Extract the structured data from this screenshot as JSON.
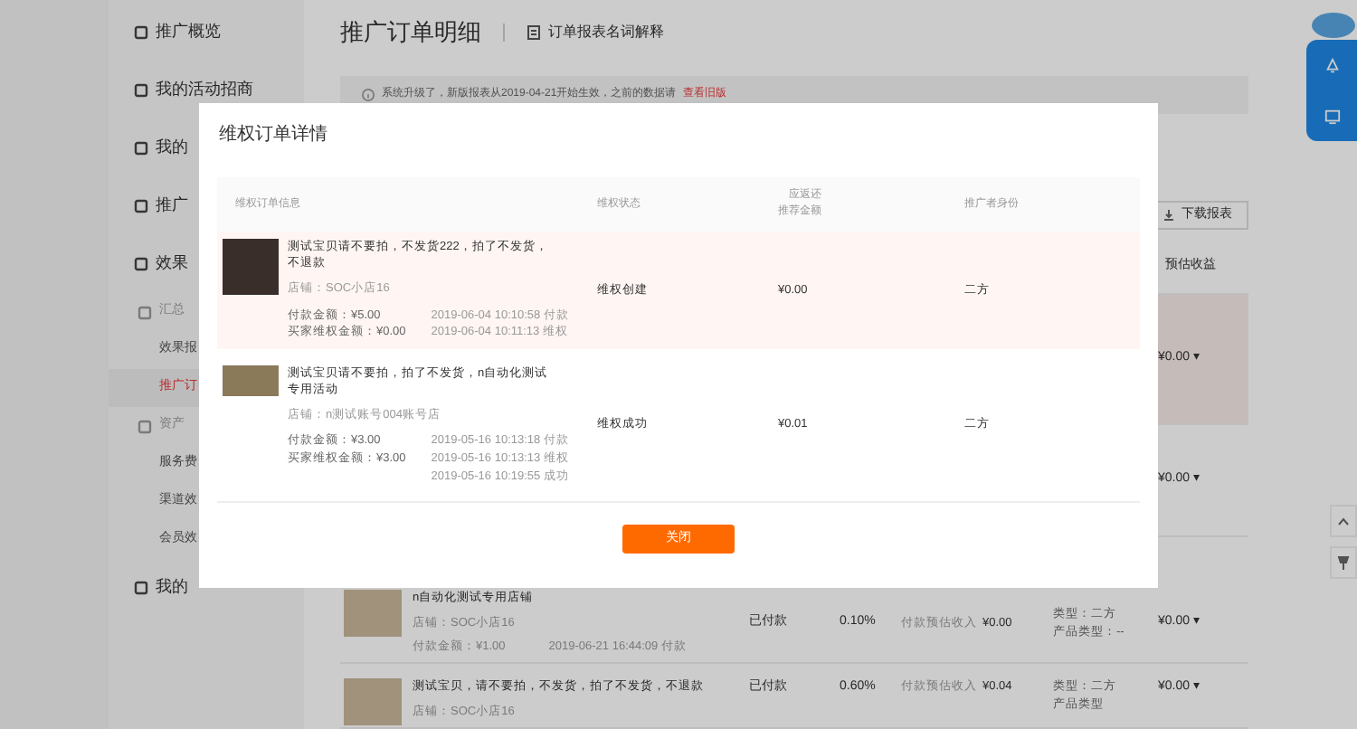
{
  "sidebar": {
    "items": [
      {
        "kind": "item",
        "label": "推广概览",
        "selected": false
      },
      {
        "kind": "item",
        "label": "我的活动招商",
        "selected": false
      },
      {
        "kind": "item",
        "label": "我的",
        "selected": false
      },
      {
        "kind": "item",
        "label": "推广",
        "selected": false
      },
      {
        "kind": "item",
        "label": "效果",
        "selected": false
      },
      {
        "kind": "group",
        "label": "汇总",
        "selected": false
      },
      {
        "kind": "sub",
        "label": "效果报",
        "selected": false
      },
      {
        "kind": "sub",
        "label": "推广订",
        "selected": true
      },
      {
        "kind": "group",
        "label": "资产",
        "selected": false
      },
      {
        "kind": "sub",
        "label": "服务费",
        "selected": false
      },
      {
        "kind": "sub",
        "label": "渠道效",
        "selected": false
      },
      {
        "kind": "sub",
        "label": "会员效",
        "selected": false
      },
      {
        "kind": "item",
        "label": "我的",
        "selected": false
      }
    ]
  },
  "header": {
    "title": "推广订单明细",
    "help_link": "订单报表名词解释"
  },
  "notice": {
    "text": "系统升级了，新版报表从2019-04-21开始生效，之前的数据请",
    "link": "查看旧版"
  },
  "toolbar": {
    "download_button": "下载报表"
  },
  "table": {
    "column_heading": "预估收益",
    "rows": [
      {
        "selected": true,
        "amount": "¥0.00 ▾"
      },
      {
        "selected": false,
        "amount": "¥0.00 ▾"
      },
      {
        "selected": false,
        "title": "n自动化测试专用店铺",
        "shop": "店铺：SOC小店16",
        "paid": "付款金额：¥1.00",
        "time": "2019-06-21 16:44:09 付款",
        "status": "已付款",
        "rate": "0.10%",
        "income_label": "付款预估收入",
        "income": "¥0.00",
        "type": "类型：二方",
        "product_type": "产品类型：--",
        "amount": "¥0.00 ▾"
      },
      {
        "selected": false,
        "title": "测试宝贝，请不要拍，不发货，拍了不发货，不退款",
        "shop": "店铺：SOC小店16",
        "status": "已付款",
        "rate": "0.60%",
        "income_label": "付款预估收入",
        "income": "¥0.04",
        "type": "类型：二方",
        "product_type": "产品类型",
        "amount": "¥0.00 ▾"
      }
    ]
  },
  "dialog": {
    "title": "维权订单详情",
    "columns": [
      "维权订单信息",
      "维权状态",
      "应返还推荐金额",
      "推广者身份"
    ],
    "rows": [
      {
        "selected": true,
        "title": "测试宝贝请不要拍，不发货222，拍了不发货，不退款",
        "shop": "店铺：SOC小店16",
        "paid": "付款金额：¥5.00",
        "refund": "买家维权金额：¥0.00",
        "times": [
          "2019-06-04 10:10:58 付款",
          "2019-06-04 10:11:13 维权"
        ],
        "status": "维权创建",
        "amount": "¥0.00",
        "role": "二方"
      },
      {
        "selected": false,
        "title": "测试宝贝请不要拍，拍了不发货，n自动化测试专用活动",
        "shop": "店铺：n测试账号004账号店",
        "paid": "付款金额：¥3.00",
        "refund": "买家维权金额：¥3.00",
        "times": [
          "2019-05-16 10:13:18 付款",
          "2019-05-16 10:13:13 维权",
          "2019-05-16 10:19:55 成功"
        ],
        "status": "维权成功",
        "amount": "¥0.01",
        "role": "二方"
      }
    ],
    "close_button": "关闭"
  }
}
